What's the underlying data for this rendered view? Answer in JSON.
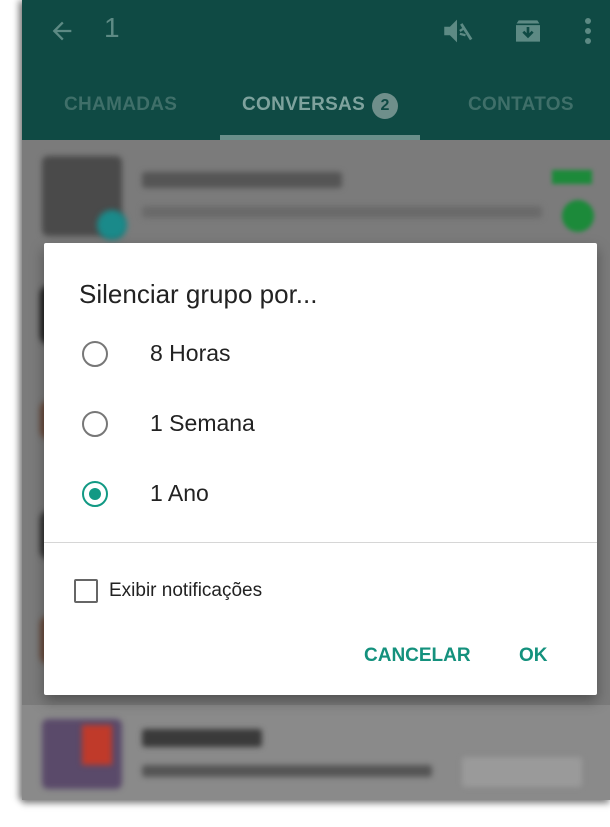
{
  "toolbar": {
    "selected_count": "1",
    "icons": [
      "back-arrow-icon",
      "mute-icon",
      "archive-icon",
      "more-vert-icon"
    ]
  },
  "tabs": [
    {
      "label": "CHAMADAS",
      "active": false
    },
    {
      "label": "CONVERSAS",
      "active": true,
      "badge": "2"
    },
    {
      "label": "CONTATOS",
      "active": false
    }
  ],
  "dialog": {
    "title": "Silenciar grupo por...",
    "options": [
      {
        "label": "8 Horas",
        "checked": false
      },
      {
        "label": "1 Semana",
        "checked": false
      },
      {
        "label": "1 Ano",
        "checked": true
      }
    ],
    "checkbox_label": "Exibir notificações",
    "checkbox_checked": false,
    "cancel_label": "CANCELAR",
    "ok_label": "OK"
  },
  "colors": {
    "toolbar": "#0f4a44",
    "accent": "#129984",
    "button_text": "#14917d",
    "overlay": "#7b7b7b"
  }
}
